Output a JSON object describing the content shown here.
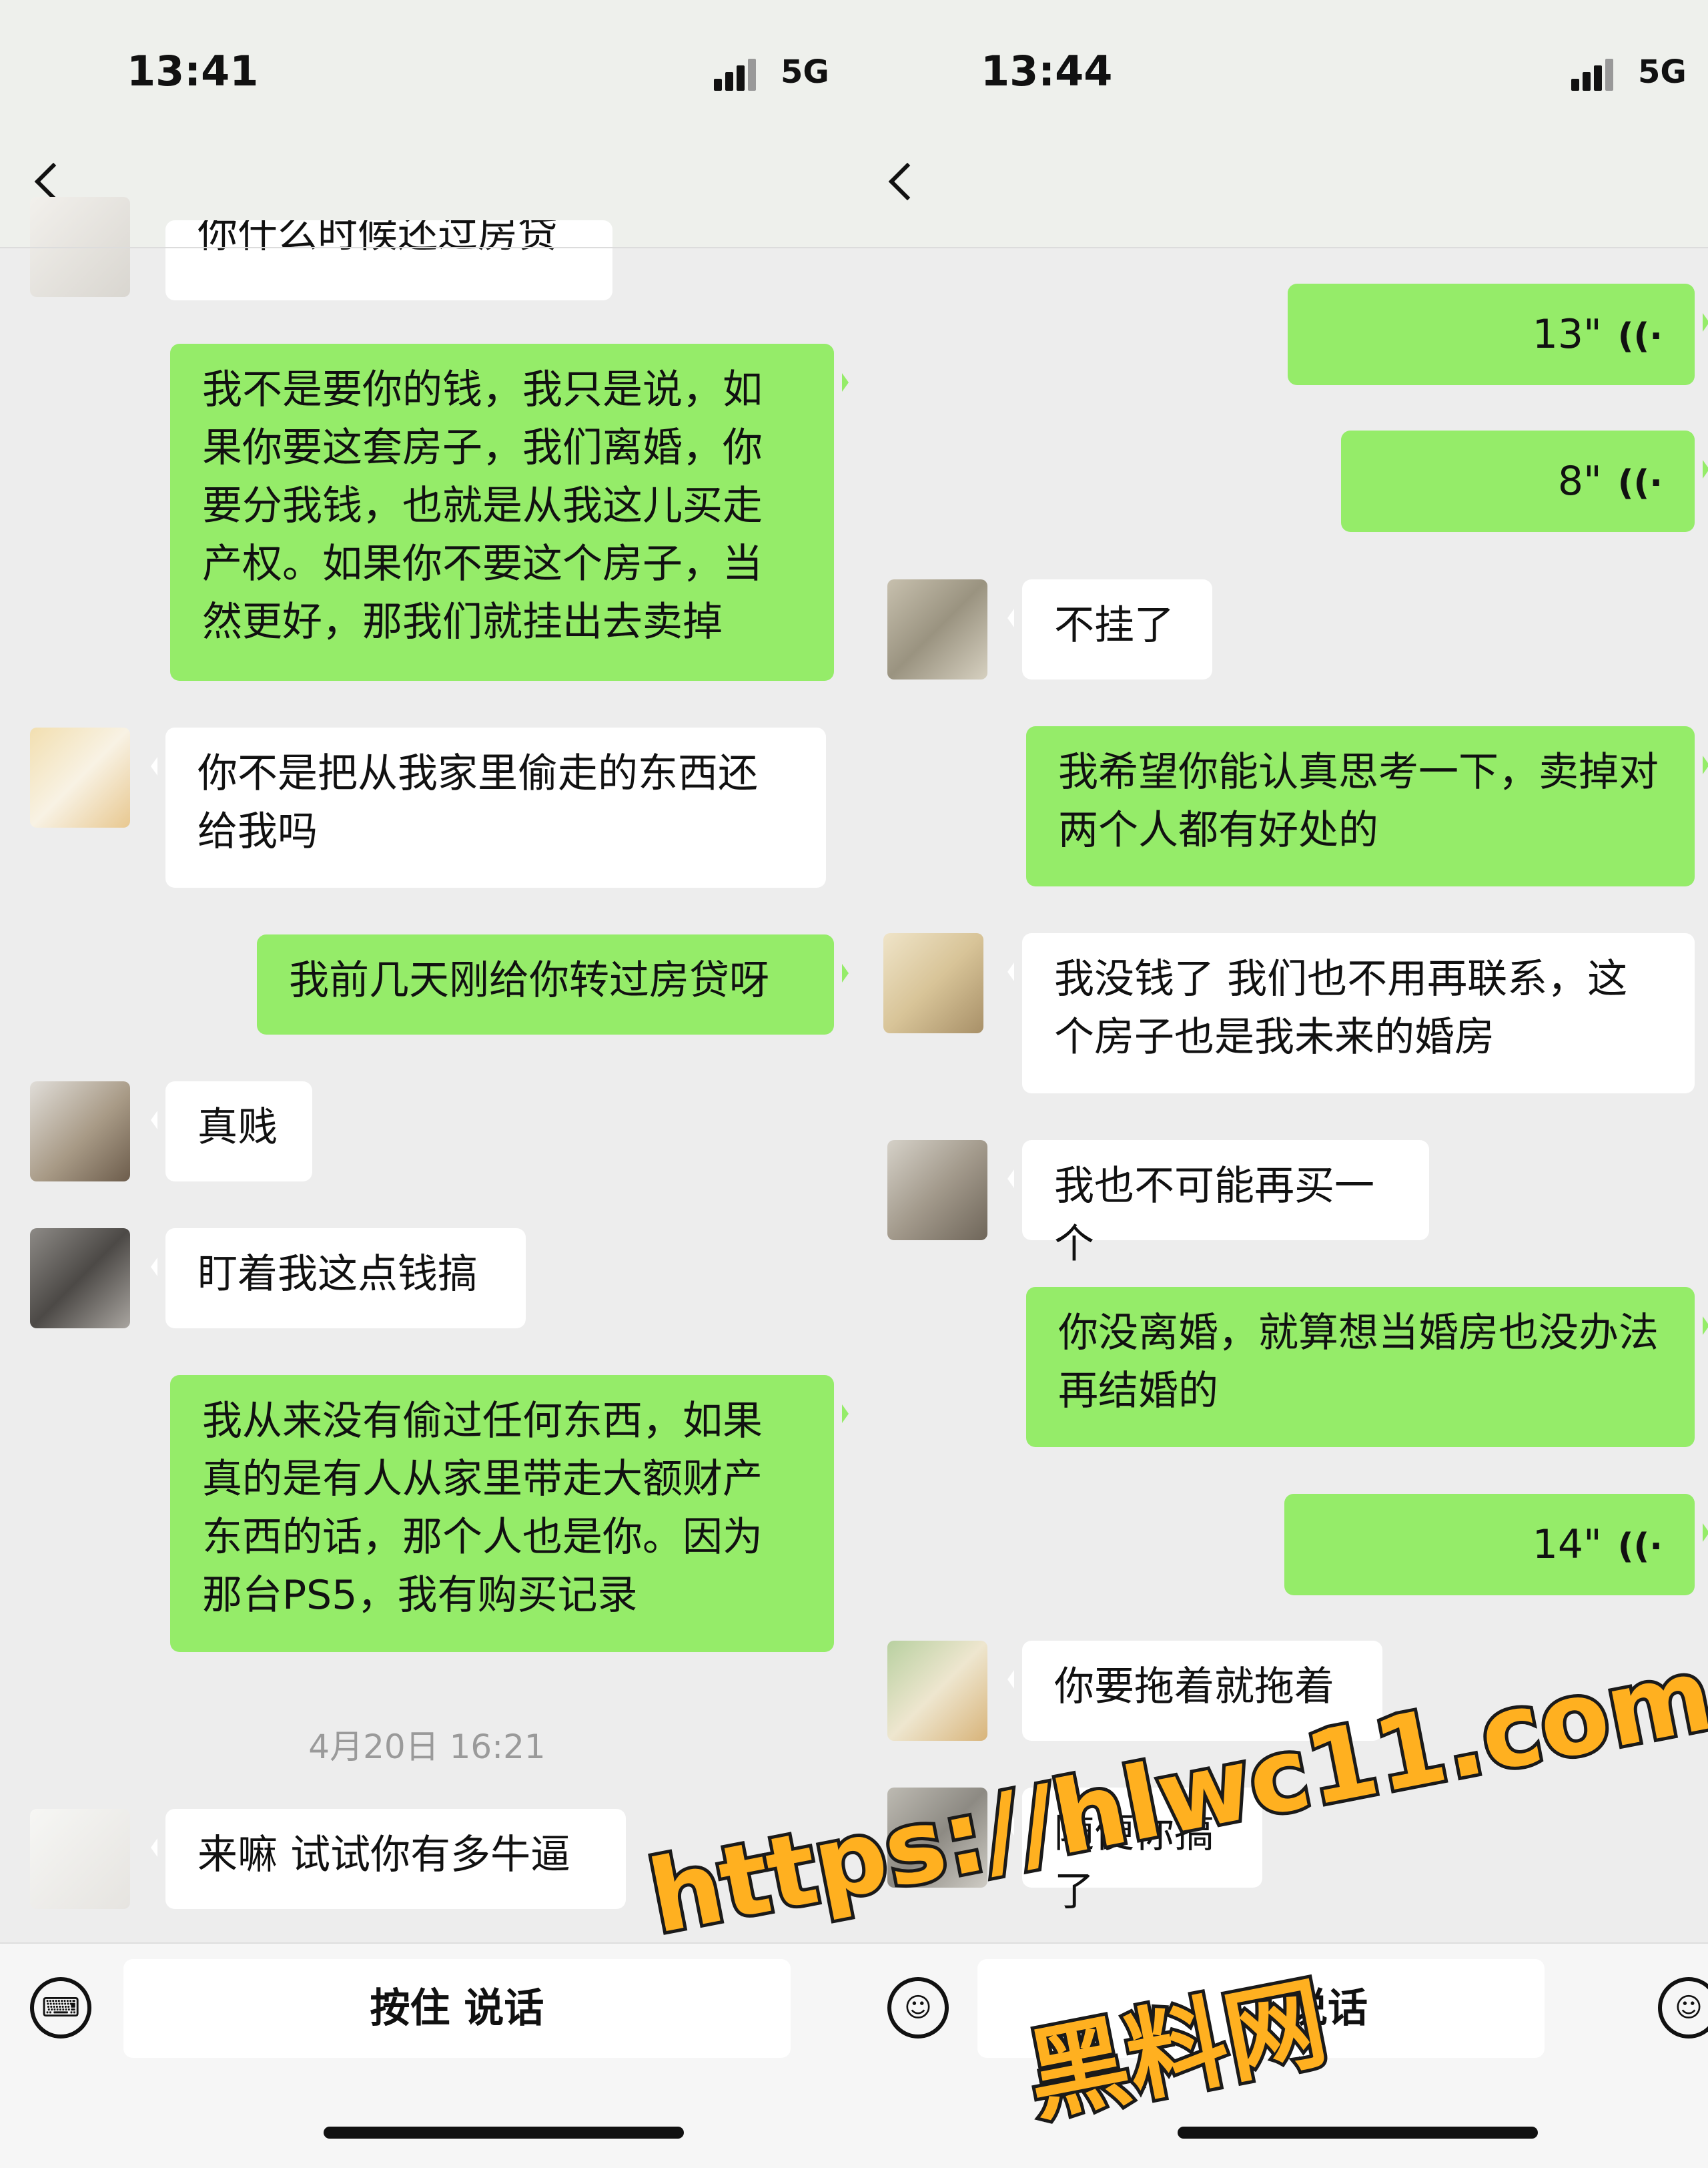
{
  "left": {
    "status": {
      "time": "13:41",
      "network": "5G"
    },
    "partial_message": "你什么时候还过房贷",
    "messages": [
      {
        "from": "me",
        "text": "我不是要你的钱，我只是说，如果你要这套房子，我们离婚，你要分我钱，也就是从我这儿买走产权。如果你不要这个房子，当然更好，那我们就挂出去卖掉"
      },
      {
        "from": "other",
        "text": "你不是把从我家里偷走的东西还给我吗"
      },
      {
        "from": "me",
        "text": "我前几天刚给你转过房贷呀"
      },
      {
        "from": "other",
        "text": "真贱"
      },
      {
        "from": "other",
        "text": "盯着我这点钱搞"
      },
      {
        "from": "me",
        "text": "我从来没有偷过任何东西，如果真的是有人从家里带走大额财产东西的话，那个人也是你。因为那台PS5，我有购买记录"
      },
      {
        "from": "other",
        "text": "来嘛 试试你有多牛逼"
      }
    ],
    "timestamp": "4月20日 16:21",
    "input": {
      "hold_to_talk": "按住 说话"
    }
  },
  "right": {
    "status": {
      "time": "13:44",
      "network": "5G"
    },
    "messages": [
      {
        "from": "me",
        "type": "voice",
        "duration": "13\""
      },
      {
        "from": "me",
        "type": "voice",
        "duration": "8\""
      },
      {
        "from": "other",
        "text": "不挂了"
      },
      {
        "from": "me",
        "text": "我希望你能认真思考一下，卖掉对两个人都有好处的"
      },
      {
        "from": "other",
        "text": "我没钱了 我们也不用再联系，这个房子也是我未来的婚房"
      },
      {
        "from": "other",
        "text": "我也不可能再买一个"
      },
      {
        "from": "me",
        "text": "你没离婚，就算想当婚房也没办法再结婚的"
      },
      {
        "from": "me",
        "type": "voice",
        "duration": "14\""
      },
      {
        "from": "other",
        "text": "你要拖着就拖着"
      },
      {
        "from": "other",
        "text": "随便你搞了"
      }
    ],
    "input": {
      "hold_to_talk": "说话"
    }
  },
  "watermark": {
    "url": "https://hlwc11.com",
    "site": "黑料网"
  },
  "icons": {
    "back": "back-chevron-icon",
    "keyboard": "keyboard-icon",
    "emoji": "emoji-icon",
    "voice_wave": "voice-wave-icon",
    "signal": "signal-icon"
  },
  "colors": {
    "out_bubble": "#95ec69",
    "in_bubble": "#ffffff",
    "background": "#ededed"
  }
}
